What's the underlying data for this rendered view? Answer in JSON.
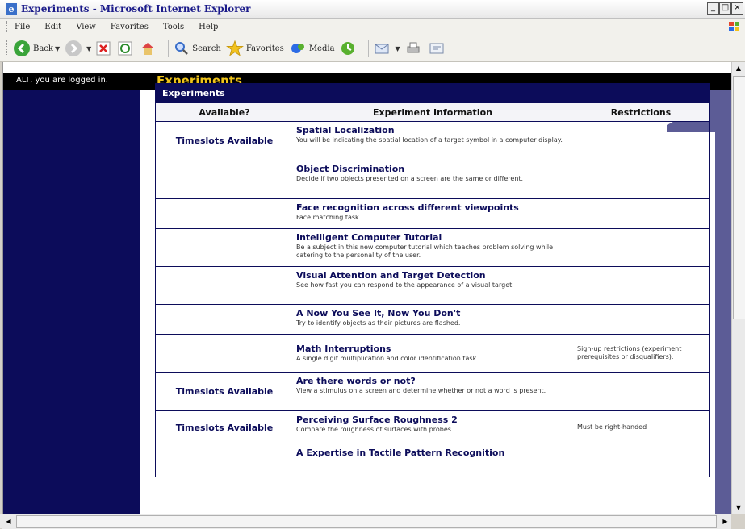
{
  "window": {
    "title": "Experiments - Microsoft Internet Explorer",
    "min": "_",
    "max": "□",
    "close": "×"
  },
  "menu": [
    "File",
    "Edit",
    "View",
    "Favorites",
    "Tools",
    "Help"
  ],
  "toolbar": {
    "back": "Back",
    "search": "Search",
    "favorites": "Favorites",
    "media": "Media"
  },
  "page": {
    "logged_in": "ALT, you are logged in.",
    "title": "Experiments"
  },
  "table": {
    "caption": "Experiments",
    "headers": [
      "Available?",
      "Experiment Information",
      "Restrictions"
    ],
    "rows": [
      {
        "available": "Timeslots Available",
        "name": "Spatial Localization",
        "desc": "You will be indicating the spatial location of a target symbol in a computer display.",
        "restriction": ""
      },
      {
        "available": "",
        "name": "Object Discrimination",
        "desc": "Decide if two objects presented on a screen are the same or different.",
        "restriction": ""
      },
      {
        "available": "",
        "name": "Face recognition across different viewpoints",
        "desc": "Face matching task",
        "restriction": ""
      },
      {
        "available": "",
        "name": "Intelligent Computer Tutorial",
        "desc": "Be a subject in this new computer tutorial which teaches problem solving while catering to the personality of the user.",
        "restriction": ""
      },
      {
        "available": "",
        "name": "Visual Attention and Target Detection",
        "desc": "See how fast you can respond to the appearance of a visual target",
        "restriction": ""
      },
      {
        "available": "",
        "name": "A Now You See It, Now You Don't",
        "desc": "Try to identify objects as their pictures are flashed.",
        "restriction": ""
      },
      {
        "available": "",
        "name": "Math Interruptions",
        "desc": "A single digit multiplication and color identification task.",
        "restriction": "Sign-up restrictions (experiment prerequisites or disqualifiers)."
      },
      {
        "available": "Timeslots Available",
        "name": "Are there words or not?",
        "desc": "View a stimulus on a screen and determine whether or not a word is present.",
        "restriction": ""
      },
      {
        "available": "Timeslots Available",
        "name": "Perceiving Surface Roughness 2",
        "desc": "Compare the roughness of surfaces with probes.",
        "restriction": "Must be right-handed"
      },
      {
        "available": "",
        "name": "A Expertise in Tactile Pattern Recognition",
        "desc": "",
        "restriction": ""
      }
    ]
  },
  "colors": {
    "navy": "#0c0c5a",
    "gold": "#f0c419",
    "purple": "#5c5c96"
  }
}
